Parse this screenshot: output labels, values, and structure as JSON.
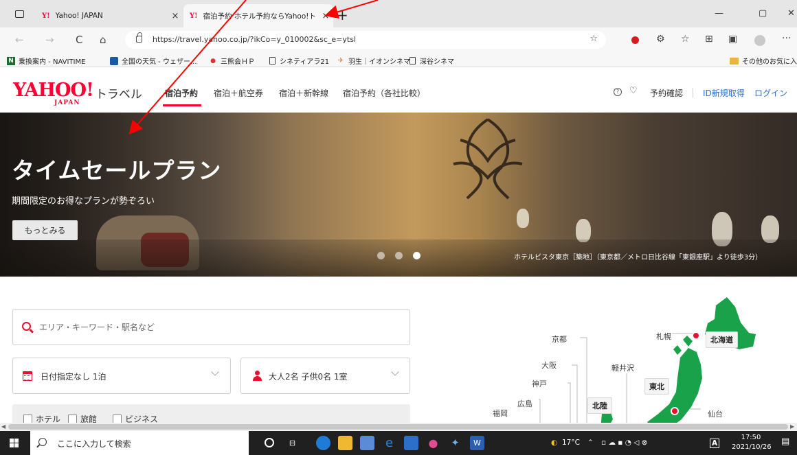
{
  "browser": {
    "tabs": [
      {
        "favicon": "Y!",
        "title": "Yahoo! JAPAN",
        "close": "×",
        "active": false
      },
      {
        "favicon": "Y!",
        "title": "宿泊予約 ホテル予約ならYahoo!ト",
        "close": "×",
        "active": true
      }
    ],
    "new_tab": "+",
    "window_controls": {
      "minimize": "—",
      "restore": "▢",
      "close": "✕"
    },
    "url": "https://travel.yahoo.co.jp/?ikCo=y_010002&sc_e=ytsl",
    "nav": {
      "back": "←",
      "forward": "→",
      "reload": "C",
      "home": "⌂"
    },
    "more": "···",
    "icons": [
      "reading-mode-icon",
      "extension-icon",
      "puzzle-icon",
      "favorites-icon",
      "collections-icon",
      "screenshot-icon",
      "profile-icon"
    ]
  },
  "bookmarks": [
    {
      "icon": "navitime-icon",
      "label": "乗換案内 - NAVITIME"
    },
    {
      "icon": "weather-icon",
      "label": "全国の天気 - ウェザー..."
    },
    {
      "icon": "bookmark-icon",
      "label": "三熊会ＨＰ"
    },
    {
      "icon": "page-icon",
      "label": "シネティアラ21"
    },
    {
      "icon": "plane-icon",
      "label": "羽生｜イオンシネマ"
    },
    {
      "icon": "page-icon",
      "label": "深谷シネマ"
    },
    {
      "icon": "folder-icon",
      "label": "その他のお気に入り"
    }
  ],
  "site": {
    "logo": {
      "main": "YAHOO!",
      "sub": "JAPAN",
      "brand": "トラベル"
    },
    "nav": [
      "宿泊予約",
      "宿泊＋航空券",
      "宿泊＋新幹線",
      "宿泊予約（各社比較）"
    ],
    "header_links": {
      "reservation_check": "予約確認",
      "signup": "ID新規取得",
      "login": "ログイン"
    }
  },
  "hero": {
    "title": "タイムセールプラン",
    "subtitle": "期間限定のお得なプランが勢ぞろい",
    "button": "もっとみる",
    "caption": "ホテルビスタ東京［築地］（東京都／メトロ日比谷線「東銀座駅」より徒歩3分）",
    "slide_count": 3,
    "active_slide": 3
  },
  "search": {
    "keyword_placeholder": "エリア・キーワード・駅名など",
    "date_value": "日付指定なし 1泊",
    "guests_value": "大人2名 子供0名 1室",
    "types": [
      "ホテル",
      "旅館",
      "ビジネス"
    ]
  },
  "map": {
    "cities": [
      "京都",
      "大阪",
      "神戸",
      "広島",
      "福岡",
      "札幌",
      "軽井沢",
      "仙台"
    ],
    "regions": [
      "北海道",
      "東北",
      "北陸"
    ],
    "land_color": "#1aa24b"
  },
  "taskbar": {
    "search_placeholder": "ここに入力して検索",
    "weather": "17°C",
    "ime": "A",
    "time": "17:50",
    "date": "2021/10/26"
  },
  "colors": {
    "brand_red": "#ff0033",
    "icon_red": "#e8102e",
    "link_blue": "#2a6fc9",
    "annotation_red": "#ff0000"
  }
}
